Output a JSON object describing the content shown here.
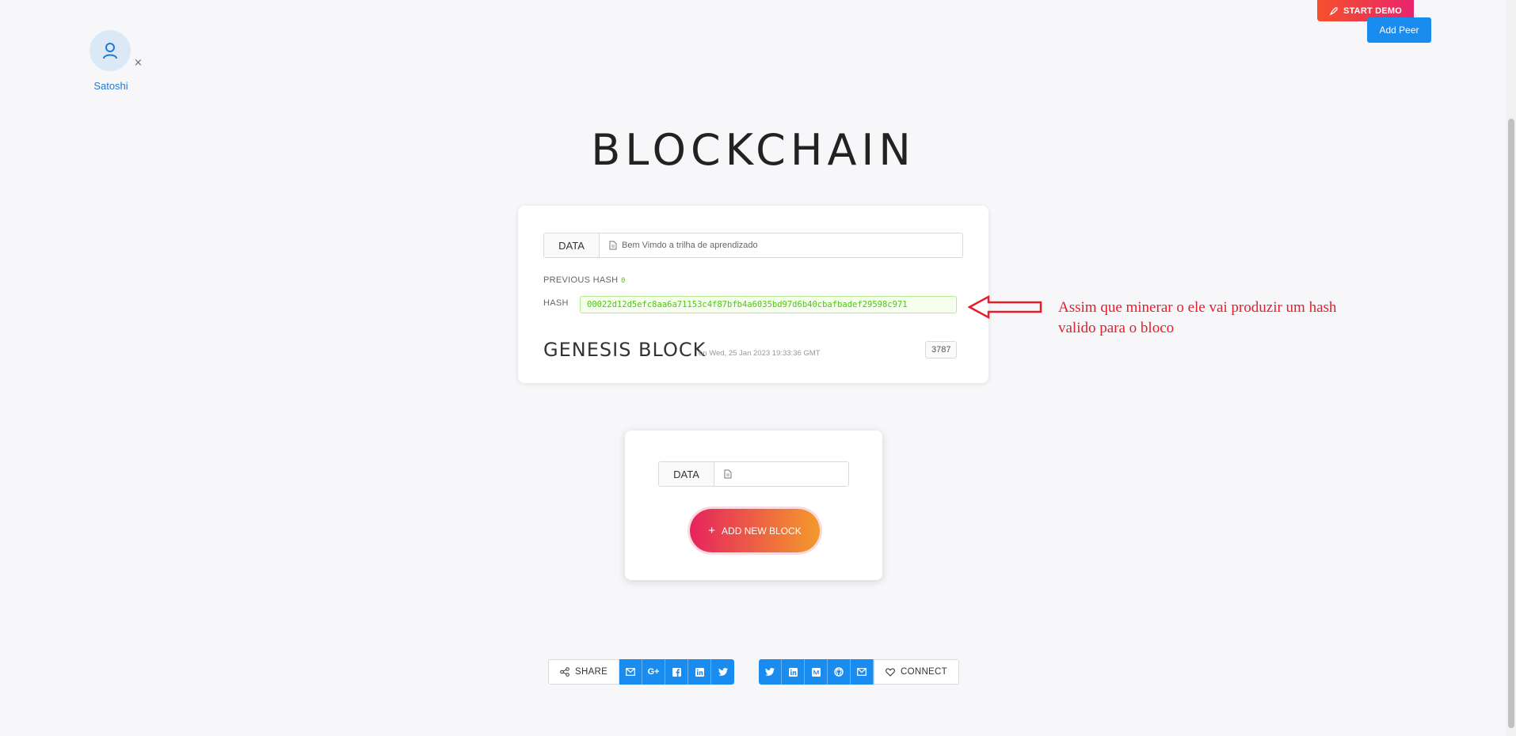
{
  "header": {
    "start_demo_label": "START DEMO",
    "add_peer_label": "Add Peer"
  },
  "peer": {
    "name": "Satoshi",
    "close_glyph": "×"
  },
  "page": {
    "title": "BLOCKCHAIN"
  },
  "genesis_block": {
    "data_label": "DATA",
    "data_value": "Bem Vimdo a trilha de aprendizado",
    "previous_hash_label": "PREVIOUS HASH",
    "previous_hash_value": "0",
    "hash_label": "HASH",
    "hash_value": "00022d12d5efc8aa6a71153c4f87bfb4a6035bd97d6b40cbafbadef29598c971",
    "title": "GENESIS BLOCK",
    "date": "on Wed, 25 Jan 2023 19:33:36 GMT",
    "nonce": "3787"
  },
  "annotation": {
    "text_line1": "Assim que minerar o ele  vai produzir um hash",
    "text_line2": "valido para o bloco",
    "color": "#e51e2b"
  },
  "new_block": {
    "data_label": "DATA",
    "data_value": "",
    "add_button_label": "ADD NEW BLOCK"
  },
  "footer": {
    "share_label": "SHARE",
    "share_icons": [
      "mail-icon",
      "google-plus-icon",
      "facebook-icon",
      "linkedin-icon",
      "twitter-icon"
    ],
    "connect_icons": [
      "twitter-icon",
      "linkedin-icon",
      "medium-icon",
      "github-icon",
      "mail-icon"
    ],
    "connect_label": "CONNECT"
  },
  "colors": {
    "accent_blue": "#1a8cf0",
    "hash_green": "#52c41a",
    "gradient_start": "#e6245e",
    "gradient_end": "#f39a2a"
  }
}
